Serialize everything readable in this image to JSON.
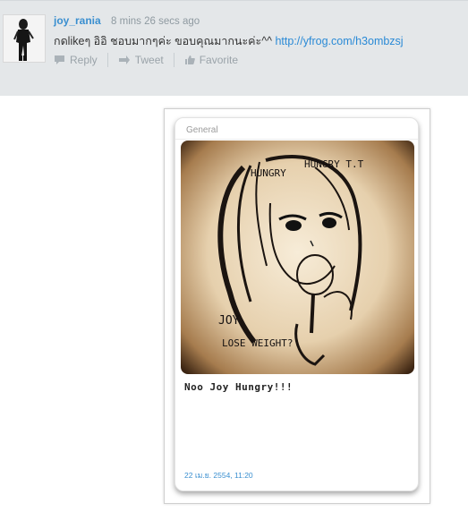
{
  "tweet": {
    "username": "joy_rania",
    "timestamp": "8 mins 26 secs ago",
    "text": "กดlikeๆ อิอิ ชอบมากๆค่ะ ขอบคุณมากนะค่ะ^^",
    "link": "http://yfrog.com/h3ombzsj",
    "actions": {
      "reply": "Reply",
      "tweet": "Tweet",
      "favorite": "Favorite"
    }
  },
  "photo": {
    "category": "General",
    "sketch_text": {
      "line1": "HUNGRY",
      "line2": "HUNGRY T.T",
      "line3": "JOY",
      "line4": "LOSE WEIGHT?"
    },
    "caption": "Noo Joy Hungry!!!",
    "date": "22 เม.ย. 2554, 11:20"
  },
  "colors": {
    "bar_bg": "#e4e7e9",
    "username": "#3a8fd0",
    "link": "#2a8ad6",
    "action_gray": "#9aa3a9"
  },
  "icons": [
    "reply-icon",
    "retweet-icon",
    "favorite-icon"
  ]
}
